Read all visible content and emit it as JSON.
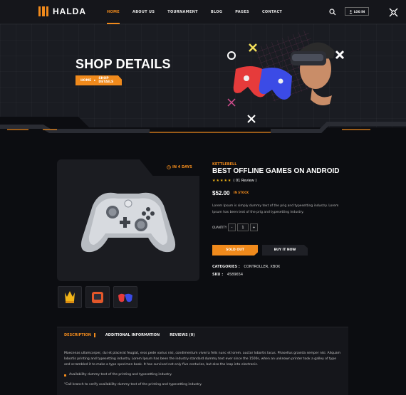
{
  "brand": {
    "name": "HALDA"
  },
  "nav": {
    "items": [
      "HOME",
      "ABOUT US",
      "TOURNAMENT",
      "BLOG",
      "PAGES",
      "CONTACT"
    ],
    "active": "HOME",
    "login": "LOG IN"
  },
  "hero": {
    "title": "SHOP DETAILS",
    "breadcrumb": {
      "home": "HOME",
      "current": "SHOP DETAILS"
    }
  },
  "product": {
    "days_left": "IN 4 DAYS",
    "category": "KETTLEBELL",
    "title": "BEST OFFLINE GAMES ON ANDROID",
    "stars": "★★★★★",
    "reviews": "( 01 Review )",
    "price": "$52.00",
    "stock": "IN STOCK",
    "description": "Lorem Ipsum is simply dummy text of the prig and typesetting industry. Lorem Ipsum has been text of the prig and typesetting industry.",
    "quantity_label": "QUANTITY",
    "quantity": "1",
    "minus": "-",
    "plus": "+",
    "sold_out": "SOLD OUT",
    "buy_it_now": "BUY IT NOW",
    "categories_label": "CATEGORIES :",
    "categories_value": "CONTROLLER, XBOX",
    "sku_label": "SKU :",
    "sku_value": "4589654",
    "accent": "#f08a1c"
  },
  "tabs": {
    "items": [
      "DESCRIPTION",
      "ADDITIONAL INFORMATION",
      "REVIEWS (0)"
    ],
    "active": "DESCRIPTION",
    "body": {
      "paragraph": "Maecenas ullamcorper, dui et placerat feugiat, eros pede varius nisi, condimentum viverra felis nunc et lorem. auctor lobortis lacus. Phasellus gravida semper nisi. Aliquam lobortis printing and typesetting industry. Lorem Ipsum has been the industry standard dummy text ever since the 1500s, when an unknown printer took a galley of type and scrambled it to make a type specimen book. It has survived not only five centuries, but also the leap into electronic.",
      "bullet": "Availability dummy text of the printing and typesetting industry.",
      "note": "\"Call branch to verify availability dummy text of the printing and typesetting industry."
    }
  },
  "icons": [
    "search-icon",
    "user-icon",
    "offcanvas-icon",
    "clock-icon",
    "trophy-icon",
    "controller-icon"
  ]
}
